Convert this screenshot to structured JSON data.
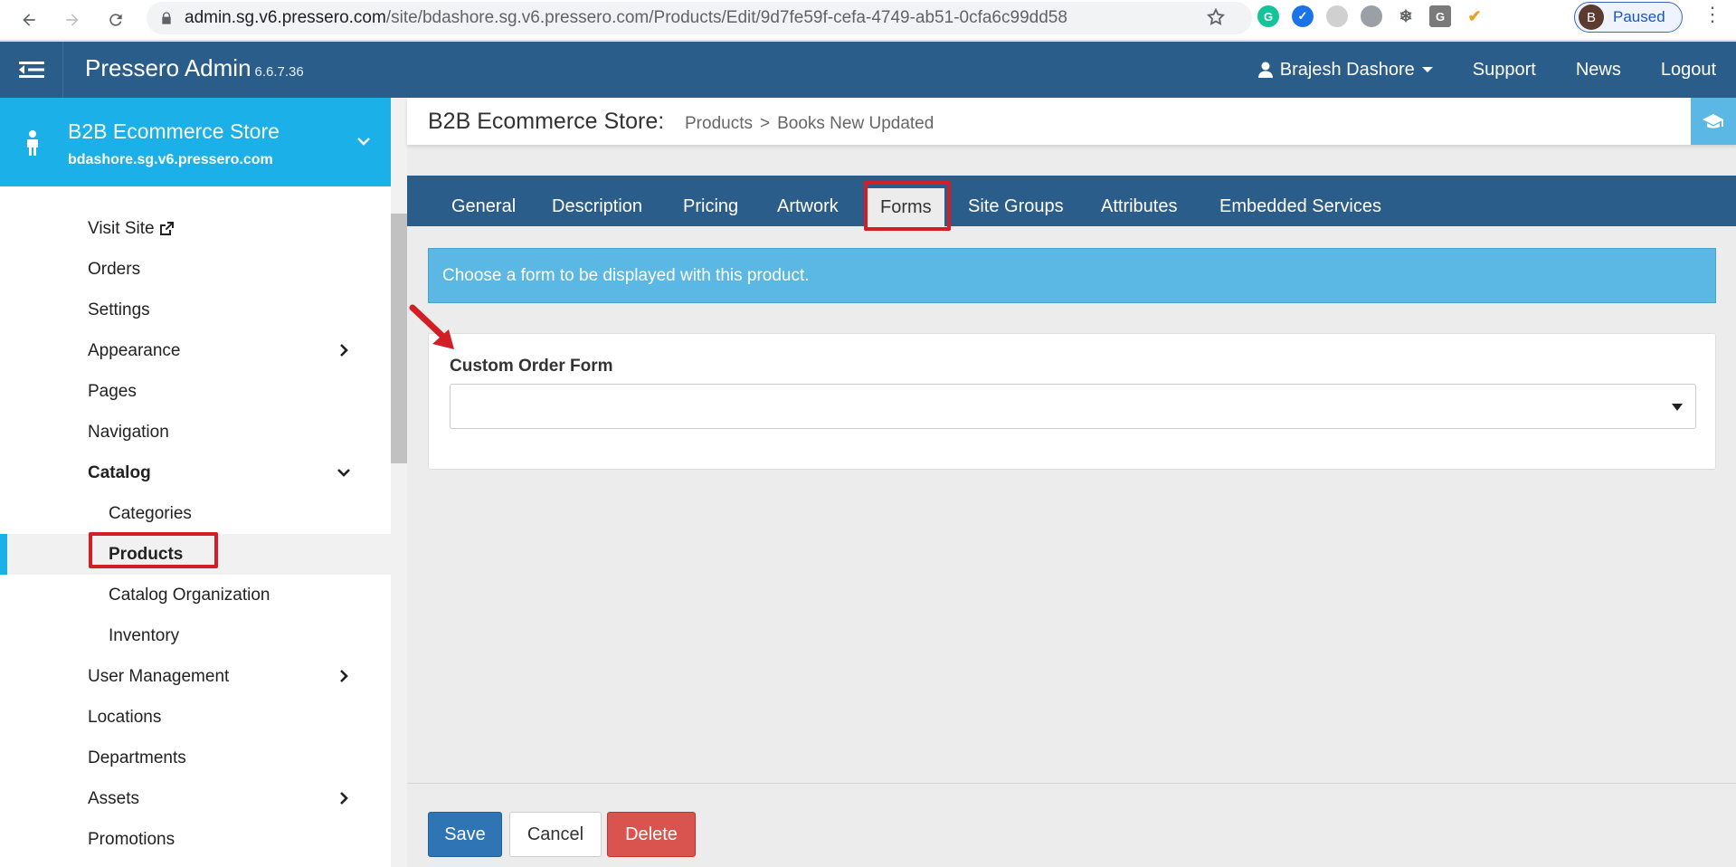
{
  "browser": {
    "url_host": "admin.sg.v6.pressero.com",
    "url_path": "/site/bdashore.sg.v6.pressero.com/Products/Edit/9d7fe59f-cefa-4749-ab51-0cfa6c99dd58",
    "profile_initial": "B",
    "profile_status": "Paused",
    "extensions": [
      "grammarly-icon",
      "checkmark-extension-icon",
      "circle-extension-icon",
      "chat-bubble-extension-icon",
      "snowflake-extension-icon",
      "g-extension-icon",
      "tick-extension-icon"
    ],
    "ext_g_label": "G"
  },
  "header": {
    "app_title": "Pressero Admin",
    "version": "6.6.7.36",
    "user": "Brajesh Dashore",
    "links": [
      "Support",
      "News",
      "Logout"
    ]
  },
  "store": {
    "name": "B2B Ecommerce Store",
    "domain": "bdashore.sg.v6.pressero.com"
  },
  "sidebar": {
    "items": [
      {
        "label": "Visit Site"
      },
      {
        "label": "Orders"
      },
      {
        "label": "Settings"
      },
      {
        "label": "Appearance"
      },
      {
        "label": "Pages"
      },
      {
        "label": "Navigation"
      },
      {
        "label": "Catalog"
      },
      {
        "label": "Categories"
      },
      {
        "label": "Products"
      },
      {
        "label": "Catalog Organization"
      },
      {
        "label": "Inventory"
      },
      {
        "label": "User Management"
      },
      {
        "label": "Locations"
      },
      {
        "label": "Departments"
      },
      {
        "label": "Assets"
      },
      {
        "label": "Promotions"
      }
    ],
    "active_item": "Products"
  },
  "page": {
    "title": "B2B Ecommerce Store:",
    "breadcrumb": [
      "Products",
      "Books New Updated"
    ],
    "breadcrumb_separator": ">"
  },
  "tabs": {
    "items": [
      "General",
      "Description",
      "Pricing",
      "Artwork",
      "Forms",
      "Site Groups",
      "Attributes",
      "Embedded Services"
    ],
    "active": "Forms"
  },
  "alert": {
    "text": "Choose a form to be displayed with this product."
  },
  "form": {
    "label": "Custom Order Form",
    "selected_value": ""
  },
  "footer": {
    "save": "Save",
    "cancel": "Cancel",
    "delete": "Delete"
  },
  "colors": {
    "header_bg": "#2b5d8a",
    "store_card_bg": "#1bb1e8",
    "alert_bg": "#5bb7e3",
    "save_bg": "#2f74b5",
    "delete_bg": "#d9534f",
    "annotation_red": "#d21f26"
  }
}
